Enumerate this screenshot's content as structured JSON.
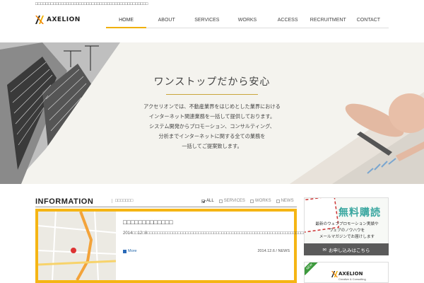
{
  "header": {
    "topline": "□□□□□□□□□□□□□□□□□□□□□□□□□□□□□□□□□□□□□□□□□□□□",
    "logo_text": "AXELION",
    "nav": [
      {
        "label": "HOME",
        "active": true
      },
      {
        "label": "ABOUT",
        "active": false
      },
      {
        "label": "SERVICES",
        "active": false
      },
      {
        "label": "WORKS",
        "active": false
      },
      {
        "label": "ACCESS",
        "active": false
      },
      {
        "label": "RECRUITMENT",
        "active": false
      },
      {
        "label": "CONTACT",
        "active": false
      }
    ]
  },
  "hero": {
    "title": "ワンストップだから安心",
    "lines": [
      "アクセリオンでは、不動産業界をはじめとした業界における",
      "インターネット関連業務を一括して提供しております。",
      "システム開発からプロモーション、コンサルティング、",
      "分析までインターネットに関する全ての業務を",
      "一括してご提案致します。"
    ],
    "slide_count": 4,
    "active_slide": 1
  },
  "information": {
    "title": "INFORMATION",
    "subtitle": "□□□□□□□",
    "filters": [
      {
        "label": "ALL",
        "checked": true
      },
      {
        "label": "SERVICES",
        "checked": false
      },
      {
        "label": "WORKS",
        "checked": false
      },
      {
        "label": "NEWS",
        "checked": false
      }
    ],
    "news": {
      "title": "□□□□□□□□□□□□□",
      "body": "2014□□12□8□□□□□□□□□□□□□□□□□□□□□□□□□□□□□□□□□□□□□□□□□□□□□□□□□□□□□□□□□□□□□□□□□□□□□□□□□□□□□□□□...",
      "more": "More",
      "date": "2014.12.6 / NEWS"
    }
  },
  "side": {
    "ad_title": "無料購読",
    "ad_lines": [
      "最新のウェブプロモーション実績や",
      "ウェブのノウハウを",
      "メールマガジンでお届けします"
    ],
    "button": "お申し込みはこちら",
    "new_tag": "NEW",
    "banner_logo": "AXELION",
    "banner_sub": "Creative & Consulting"
  },
  "colors": {
    "accent": "#f0b000",
    "card_border": "#f5b514",
    "ad_title": "#3aa7a0"
  }
}
